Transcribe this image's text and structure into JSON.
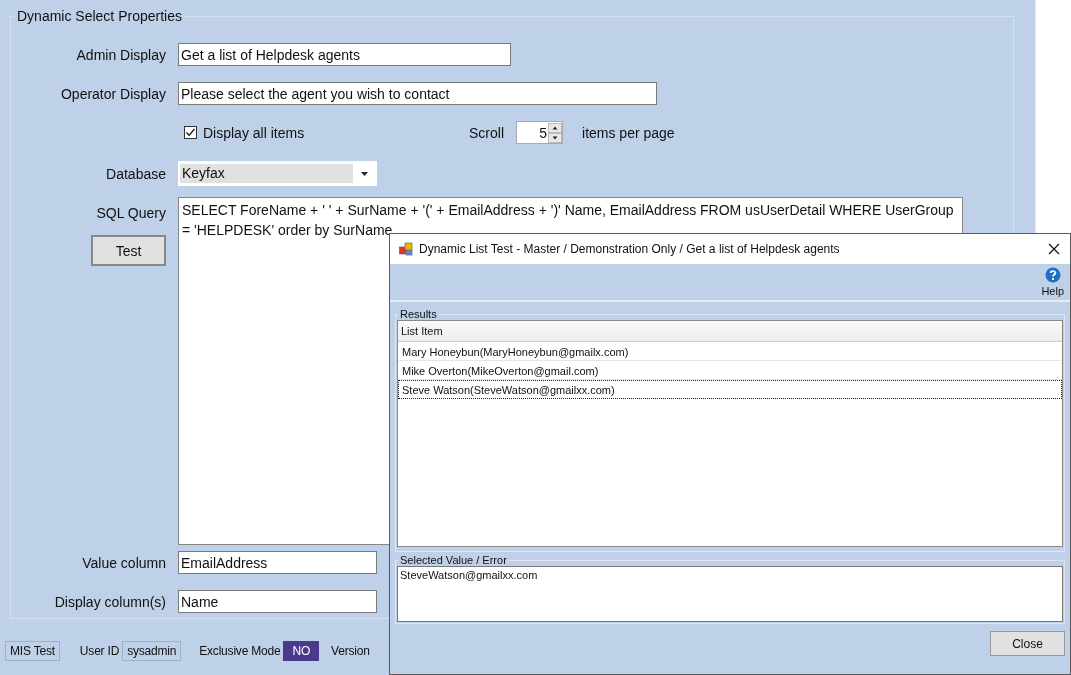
{
  "form": {
    "title": "Dynamic Select Properties",
    "admin_display": {
      "label": "Admin Display",
      "value": "Get a list of Helpdesk agents"
    },
    "operator_display": {
      "label": "Operator Display",
      "value": "Please select the agent you wish to contact"
    },
    "display_all": {
      "label": "Display all items",
      "checked": true
    },
    "scroll": {
      "label": "Scroll",
      "value": "5",
      "suffix": "items per page"
    },
    "database": {
      "label": "Database",
      "value": "Keyfax"
    },
    "sql_query": {
      "label": "SQL Query",
      "value": "SELECT ForeName + ' ' + SurName + '(' + EmailAddress + ')' Name, EmailAddress FROM usUserDetail WHERE UserGroup = 'HELPDESK' order by SurName"
    },
    "test_button": "Test",
    "value_column": {
      "label": "Value column",
      "value": "EmailAddress"
    },
    "display_columns": {
      "label": "Display column(s)",
      "value": "Name"
    }
  },
  "status_bar": {
    "site": "MIS Test",
    "user_id_label": "User ID",
    "user_id": "sysadmin",
    "exclusive_label": "Exclusive Mode",
    "exclusive": "NO",
    "version_label": "Version"
  },
  "dialog": {
    "title": "Dynamic List Test - Master / Demonstration Only / Get a list of Helpdesk agents",
    "help": "Help",
    "results_label": "Results",
    "column": "List Item",
    "rows": [
      {
        "text": "Mary Honeybun(MaryHoneybun@gmailx.com)",
        "selected": false
      },
      {
        "text": "Mike Overton(MikeOverton@gmail.com)",
        "selected": false
      },
      {
        "text": "Steve Watson(SteveWatson@gmailxx.com)",
        "selected": true
      }
    ],
    "selected_label": "Selected Value / Error",
    "selected_value": "SteveWatson@gmailxx.com",
    "close": "Close"
  }
}
